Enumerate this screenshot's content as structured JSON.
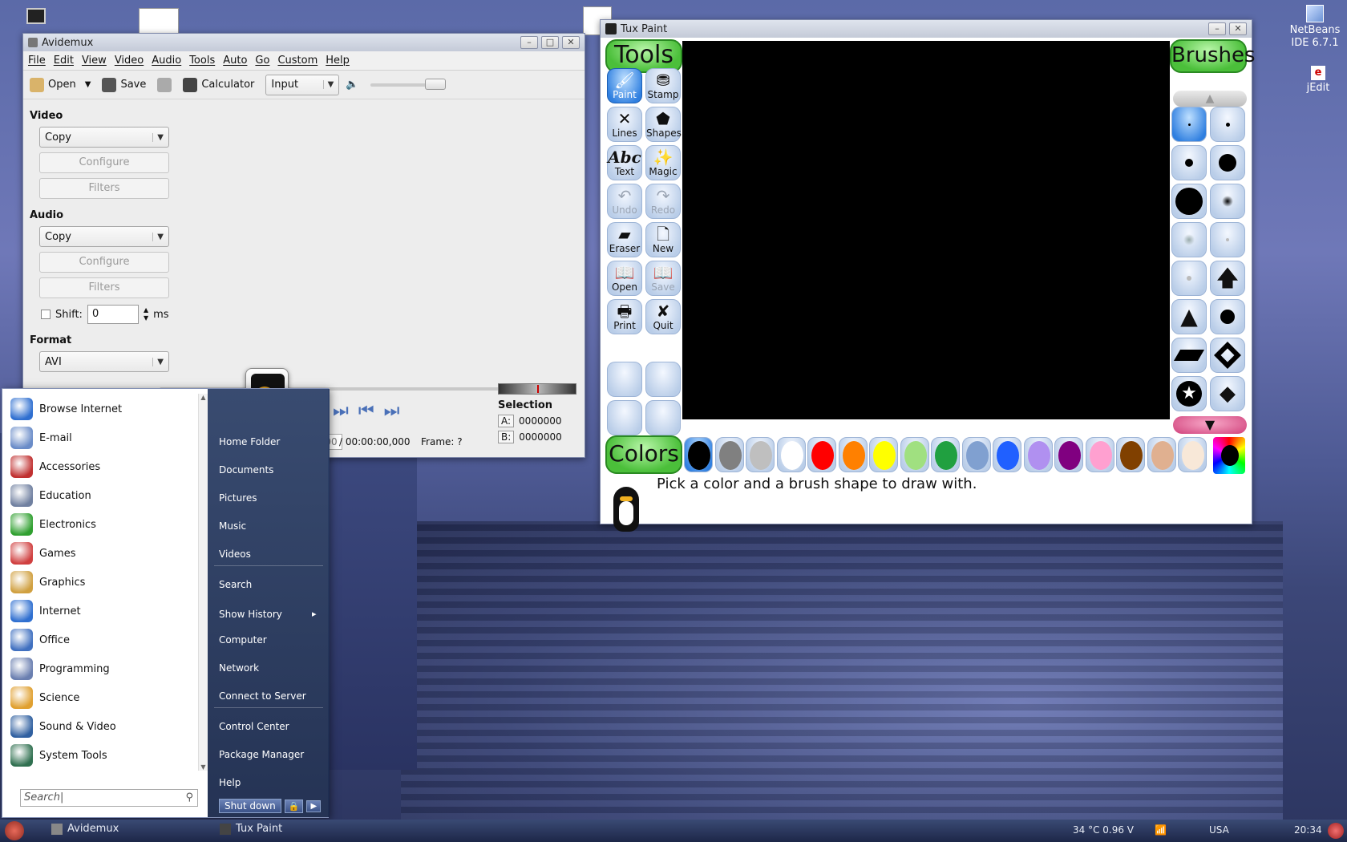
{
  "desktop": {
    "icons": [
      {
        "label": "NetBeans\nIDE 6.7.1"
      },
      {
        "label": "jEdit"
      }
    ]
  },
  "avidemux": {
    "title": "Avidemux",
    "menu": [
      "File",
      "Edit",
      "View",
      "Video",
      "Audio",
      "Tools",
      "Auto",
      "Go",
      "Custom",
      "Help"
    ],
    "toolbar": {
      "open": "Open",
      "save": "Save",
      "calculator": "Calculator",
      "input": "Input"
    },
    "video": {
      "label": "Video",
      "codec": "Copy",
      "configure": "Configure",
      "filters": "Filters"
    },
    "audio": {
      "label": "Audio",
      "codec": "Copy",
      "configure": "Configure",
      "filters": "Filters",
      "shift_label": "Shift:",
      "shift_value": "0",
      "shift_unit": "ms"
    },
    "format": {
      "label": "Format",
      "value": "AVI"
    },
    "time": {
      "current": "00:00:00.000",
      "total": "/ 00:00:00,000",
      "frame": "Frame: ?"
    },
    "selection": {
      "label": "Selection",
      "a_label": "A:",
      "a_value": "0000000",
      "b_label": "B:",
      "b_value": "0000000"
    }
  },
  "tuxpaint": {
    "title": "Tux Paint",
    "tools_header": "Tools",
    "brushes_header": "Brushes",
    "colors_header": "Colors",
    "tools": [
      {
        "label": "Paint",
        "glyph": "🖌",
        "state": "selected"
      },
      {
        "label": "Stamp",
        "glyph": "⛃",
        "state": "normal"
      },
      {
        "label": "Lines",
        "glyph": "✕",
        "state": "normal"
      },
      {
        "label": "Shapes",
        "glyph": "⬟",
        "state": "normal"
      },
      {
        "label": "Text",
        "glyph": "Abc",
        "state": "normal"
      },
      {
        "label": "Magic",
        "glyph": "✨",
        "state": "normal"
      },
      {
        "label": "Undo",
        "glyph": "↶",
        "state": "disabled"
      },
      {
        "label": "Redo",
        "glyph": "↷",
        "state": "disabled"
      },
      {
        "label": "Eraser",
        "glyph": "▰",
        "state": "normal"
      },
      {
        "label": "New",
        "glyph": "🗋",
        "state": "normal"
      },
      {
        "label": "Open",
        "glyph": "📖",
        "state": "normal"
      },
      {
        "label": "Save",
        "glyph": "📖",
        "state": "disabled"
      },
      {
        "label": "Print",
        "glyph": "🖶",
        "state": "normal"
      },
      {
        "label": "Quit",
        "glyph": "✘",
        "state": "normal"
      }
    ],
    "colors": [
      "#000000",
      "#808080",
      "#bfbfbf",
      "#ffffff",
      "#ff0000",
      "#ff8000",
      "#ffff00",
      "#a0e080",
      "#20a040",
      "#80a0d0",
      "#2060ff",
      "#b090f0",
      "#800080",
      "#ffa0d0",
      "#804000",
      "#e0b090",
      "#f8e8d8"
    ],
    "status_message": "Pick a color and a brush shape to draw with."
  },
  "startmenu": {
    "categories": [
      {
        "label": "Browse Internet",
        "icon": "globe-icon",
        "color": "#2f6fd0"
      },
      {
        "label": "E-mail",
        "icon": "mail-icon",
        "color": "#6a8cc8"
      },
      {
        "label": "Accessories",
        "icon": "tools-icon",
        "color": "#c03030"
      },
      {
        "label": "Education",
        "icon": "education-icon",
        "color": "#7080a0"
      },
      {
        "label": "Electronics",
        "icon": "electronics-icon",
        "color": "#30a030"
      },
      {
        "label": "Games",
        "icon": "cards-icon",
        "color": "#d04040"
      },
      {
        "label": "Graphics",
        "icon": "palette-icon",
        "color": "#d0a040"
      },
      {
        "label": "Internet",
        "icon": "globe-icon",
        "color": "#2f6fd0"
      },
      {
        "label": "Office",
        "icon": "office-icon",
        "color": "#4070c0"
      },
      {
        "label": "Programming",
        "icon": "programming-icon",
        "color": "#6a7fb0"
      },
      {
        "label": "Science",
        "icon": "science-icon",
        "color": "#e0a030"
      },
      {
        "label": "Sound & Video",
        "icon": "media-icon",
        "color": "#3060a0"
      },
      {
        "label": "System Tools",
        "icon": "system-icon",
        "color": "#307050"
      }
    ],
    "places": [
      "Home Folder",
      "Documents",
      "Pictures",
      "Music",
      "Videos",
      "Search",
      "Show History",
      "Computer",
      "Network",
      "Connect to Server",
      "Control Center",
      "Package Manager",
      "Help"
    ],
    "search_placeholder": "Search|",
    "shutdown": "Shut down"
  },
  "taskbar": {
    "tasks": [
      "Avidemux",
      "Tux Paint"
    ],
    "temp": "34 °C 0.96 V",
    "layout": "USA",
    "clock": "20:34"
  }
}
